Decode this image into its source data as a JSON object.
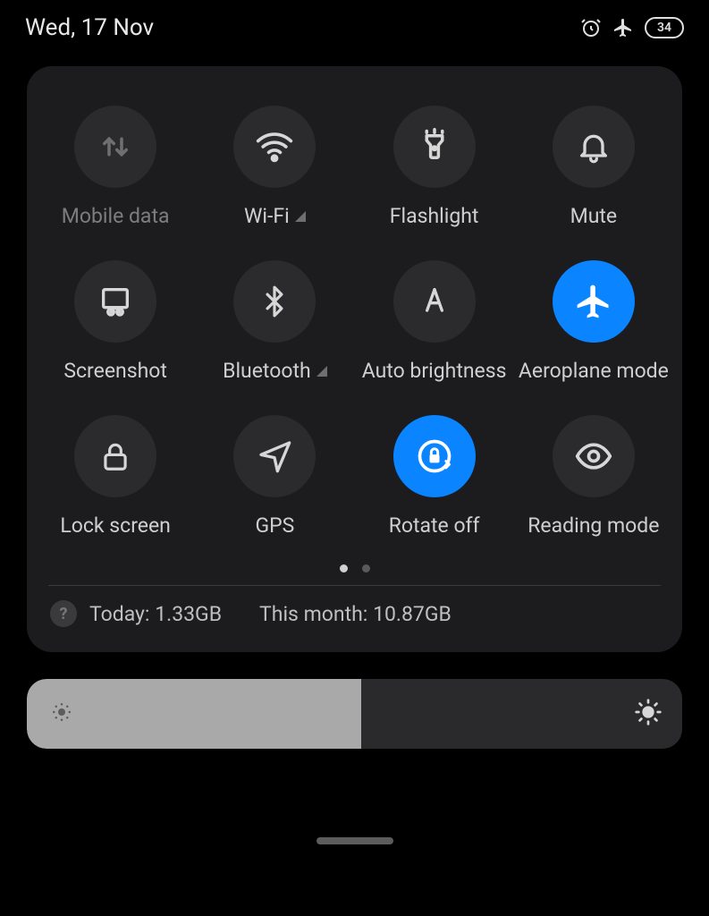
{
  "status": {
    "date": "Wed, 17 Nov",
    "battery": "34"
  },
  "tiles": [
    {
      "label": "Mobile data"
    },
    {
      "label": "Wi-Fi"
    },
    {
      "label": "Flashlight"
    },
    {
      "label": "Mute"
    },
    {
      "label": "Screenshot"
    },
    {
      "label": "Bluetooth"
    },
    {
      "label": "Auto brightness"
    },
    {
      "label": "Aeroplane mode"
    },
    {
      "label": "Lock screen"
    },
    {
      "label": "GPS"
    },
    {
      "label": "Rotate off"
    },
    {
      "label": "Reading mode"
    }
  ],
  "data_usage": {
    "today": "Today: 1.33GB",
    "month": "This month: 10.87GB"
  },
  "brightness_percent": 51
}
